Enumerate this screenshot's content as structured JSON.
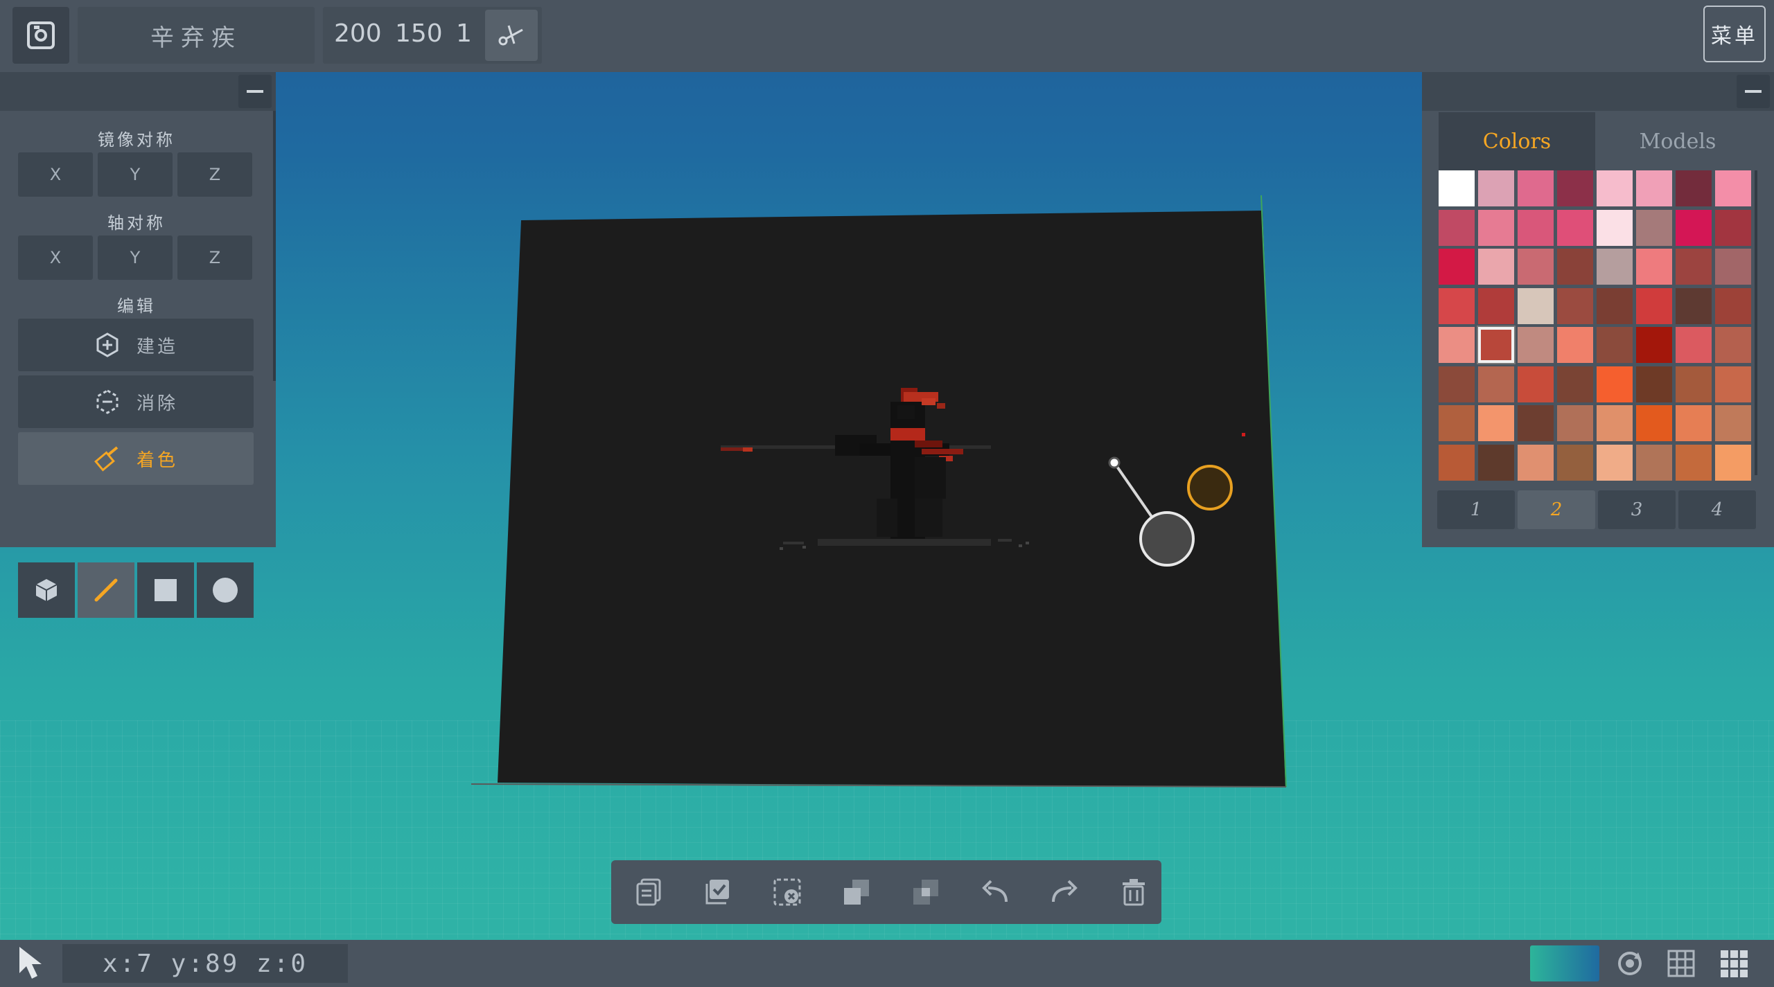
{
  "topbar": {
    "project_name": "辛弃疾",
    "width": "200",
    "height": "150",
    "depth": "1",
    "menu_label": "菜单"
  },
  "left_panel": {
    "mirror_title": "镜像对称",
    "axis_title": "轴对称",
    "edit_title": "编辑",
    "mirror_axes": [
      "X",
      "Y",
      "Z"
    ],
    "axis_axes": [
      "X",
      "Y",
      "Z"
    ],
    "tools": [
      {
        "label": "建造",
        "icon": "build-icon"
      },
      {
        "label": "消除",
        "icon": "erase-icon"
      },
      {
        "label": "着色",
        "icon": "paint-icon",
        "active": true
      }
    ],
    "shapes": [
      "cube-icon",
      "line-icon",
      "square-icon",
      "circle-icon"
    ],
    "active_shape": "line-icon"
  },
  "right_panel": {
    "tabs": [
      "Colors",
      "Models"
    ],
    "active_tab": "Colors",
    "selected_swatch": 33,
    "swatches": [
      "#ffffff",
      "#dca2b4",
      "#df6a8e",
      "#8c3049",
      "#f6bccc",
      "#f0a0b7",
      "#732c3c",
      "#f38ea8",
      "#c04a64",
      "#e67b93",
      "#d9577a",
      "#df4f78",
      "#fbe0e6",
      "#a57a7a",
      "#d41655",
      "#a23540",
      "#d31945",
      "#eaa6ac",
      "#c96a72",
      "#8a4239",
      "#b59e9e",
      "#ee7b7e",
      "#9c4440",
      "#a26668",
      "#d6474a",
      "#b03c3a",
      "#d7c6ba",
      "#9b4b40",
      "#7a3e33",
      "#d03c3c",
      "#5e3a32",
      "#9d4238",
      "#eb8e84",
      "#b8473a",
      "#c08a80",
      "#f0806a",
      "#8b4b3c",
      "#a3170b",
      "#db5a60",
      "#b4604e",
      "#8b4a3a",
      "#b46650",
      "#c84c3a",
      "#7a4434",
      "#f55f2e",
      "#6e3a26",
      "#a45a3c",
      "#c8684a",
      "#b0603e",
      "#f3956c",
      "#6d3e30",
      "#b07058",
      "#e0906a",
      "#e35a1e",
      "#e67e54",
      "#c07a5a",
      "#b85a36",
      "#5e3a2c",
      "#e09070",
      "#94603e",
      "#f0ac88",
      "#b07458",
      "#c46a3c",
      "#f49c64"
    ],
    "pages": [
      "1",
      "2",
      "3",
      "4"
    ],
    "active_page": "2"
  },
  "edit_toolbar": [
    "copy-icon",
    "select-all-icon",
    "deselect-icon",
    "duplicate-icon",
    "merge-icon",
    "undo-icon",
    "redo-icon",
    "delete-icon"
  ],
  "status": {
    "coords": "x:7 y:89 z:0"
  },
  "colors": {
    "accent": "#f5a623",
    "panel": "#4a545f",
    "canvas": "#1c1c1c"
  }
}
